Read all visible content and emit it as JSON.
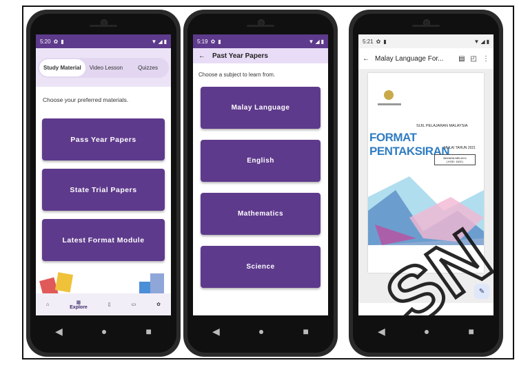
{
  "phone1": {
    "time": "5:20",
    "tabs": [
      "Study Material",
      "Video Lesson",
      "Quizzes"
    ],
    "subtitle": "Choose your preferred materials.",
    "buttons": [
      "Pass Year Papers",
      "State Trial Papers",
      "Latest Format Module"
    ],
    "bottom_nav": {
      "explore_label": "Explore"
    }
  },
  "phone2": {
    "time": "5:19",
    "title": "Past Year Papers",
    "subtitle": "Choose a subject to learn from.",
    "subjects": [
      "Malay Language",
      "English",
      "Mathematics",
      "Science"
    ]
  },
  "phone3": {
    "time": "5:21",
    "doc_title": "Malay Language For...",
    "cover": {
      "heading": "SIJIL PELAJARAN MALAYSIA",
      "big": "FORMAT PENTAKSIRAN",
      "sub": "MULAI TAHUN 2021",
      "box1": "BAHASA MELAYU",
      "box2": "( KOD: 1103 )"
    }
  },
  "colors": {
    "primary": "#5e3a8c",
    "tab_bg": "#ece4f6"
  },
  "watermark": "SN"
}
